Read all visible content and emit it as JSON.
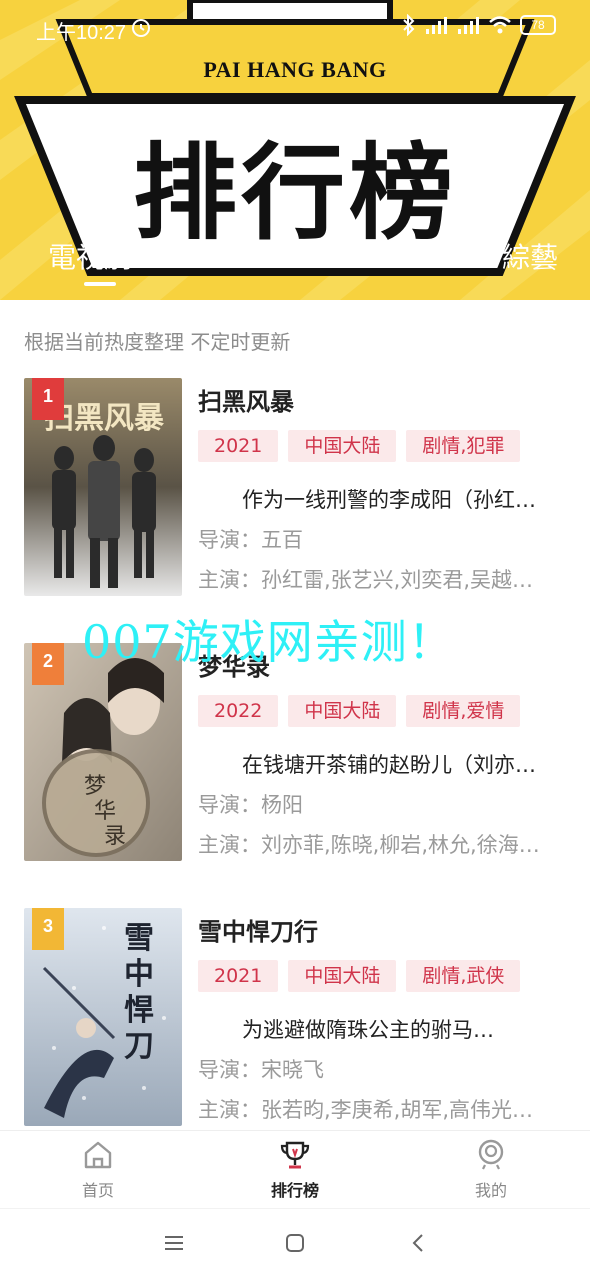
{
  "status_bar": {
    "time": "上午10:27",
    "battery": "78"
  },
  "header": {
    "pinyin_title": "PAI HANG BANG",
    "title": "排行榜",
    "tabs": [
      {
        "label": "電視劇",
        "active": true
      },
      {
        "label": "綜藝",
        "active": false
      }
    ]
  },
  "subtitle": "根据当前热度整理 不定时更新",
  "items": [
    {
      "rank": "1",
      "title": "扫黑风暴",
      "tags": [
        "2021",
        "中国大陆",
        "剧情,犯罪"
      ],
      "description": "作为一线刑警的李成阳（孙红雷 饰）…",
      "director": "导演：五百",
      "actors": "主演：孙红雷,张艺兴,刘奕君,吴越…"
    },
    {
      "rank": "2",
      "title": "梦华录",
      "tags": [
        "2022",
        "中国大陆",
        "剧情,爱情"
      ],
      "description": "在钱塘开茶铺的赵盼儿（刘亦菲 饰）…",
      "director": "导演：杨阳",
      "actors": "主演：刘亦菲,陈晓,柳岩,林允,徐海乔…"
    },
    {
      "rank": "3",
      "title": "雪中悍刀行",
      "tags": [
        "2021",
        "中国大陆",
        "剧情,武侠"
      ],
      "description": "为逃避做隋珠公主的驸马…",
      "director": "导演：宋晓飞",
      "actors": "主演：张若昀,李庚希,胡军,高伟光…"
    }
  ],
  "watermark": "007游戏网亲测！",
  "bottom_nav": [
    {
      "label": "首页",
      "icon": "home-icon"
    },
    {
      "label": "排行榜",
      "icon": "trophy-icon"
    },
    {
      "label": "我的",
      "icon": "profile-icon"
    }
  ],
  "colors": {
    "banner_yellow": "#f7d23e",
    "tag_bg": "#fbe9ea",
    "tag_text": "#d0344a",
    "rank_1": "#e03c3c",
    "rank_2": "#ef7f3a",
    "rank_3": "#f2b735",
    "watermark": "#2ef0f6"
  }
}
